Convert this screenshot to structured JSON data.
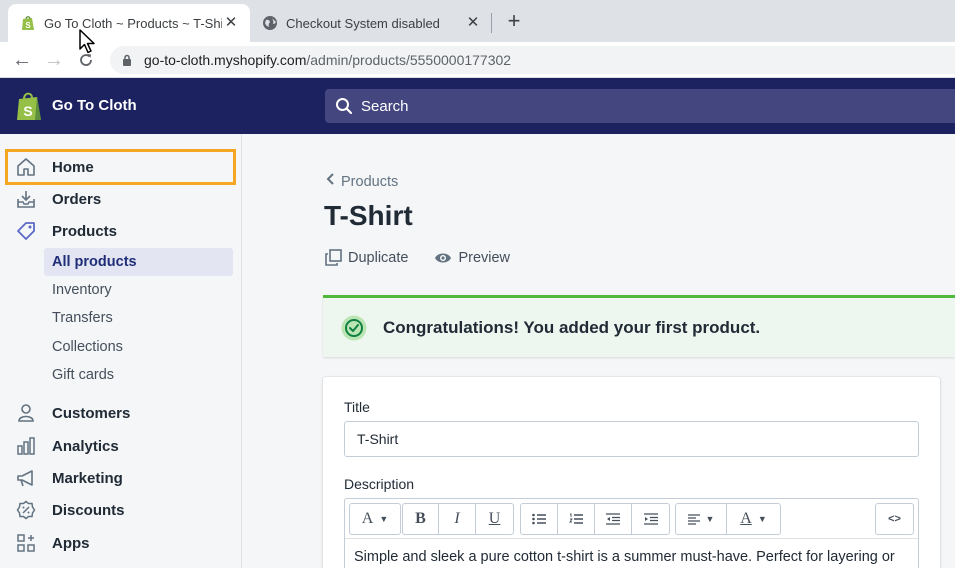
{
  "browser": {
    "tabs": [
      {
        "title": "Go To Cloth ~ Products ~ T-Shirt",
        "icon": "shopify-icon",
        "active": true
      },
      {
        "title": "Checkout System disabled",
        "icon": "globe-icon",
        "active": false
      }
    ],
    "url_host": "go-to-cloth.myshopify.com",
    "url_path": "/admin/products/5550000177302"
  },
  "topbar": {
    "store_name": "Go To Cloth",
    "search_placeholder": "Search"
  },
  "sidebar": {
    "items": [
      {
        "label": "Home",
        "icon": "home-icon"
      },
      {
        "label": "Orders",
        "icon": "orders-icon"
      },
      {
        "label": "Products",
        "icon": "tag-icon"
      },
      {
        "label": "Customers",
        "icon": "person-icon"
      },
      {
        "label": "Analytics",
        "icon": "bar-chart-icon"
      },
      {
        "label": "Marketing",
        "icon": "megaphone-icon"
      },
      {
        "label": "Discounts",
        "icon": "discount-icon"
      },
      {
        "label": "Apps",
        "icon": "apps-icon"
      }
    ],
    "products_sub": [
      "All products",
      "Inventory",
      "Transfers",
      "Collections",
      "Gift cards"
    ]
  },
  "main": {
    "breadcrumb": "Products",
    "title": "T-Shirt",
    "actions": [
      "Duplicate",
      "Preview"
    ],
    "banner": "Congratulations! You added your first product.",
    "title_label": "Title",
    "title_value": "T-Shirt",
    "description_label": "Description",
    "toolbar": {
      "font": "A",
      "bold": "B",
      "italic": "I",
      "underline": "U",
      "color": "A",
      "html": "<>"
    },
    "description_text": "Simple and sleek a pure cotton t-shirt is a summer must-have. Perfect for layering or"
  }
}
